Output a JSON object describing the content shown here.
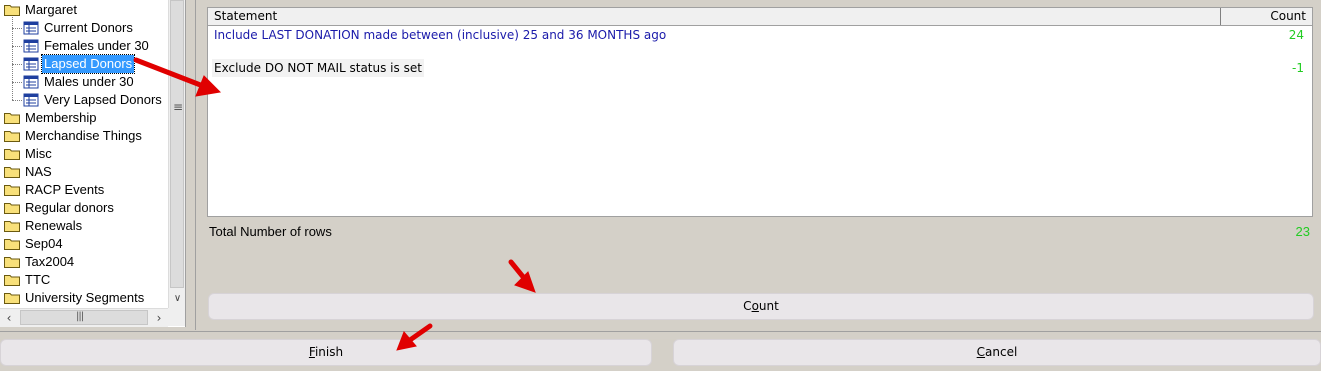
{
  "tree": {
    "items": [
      {
        "label": "Margaret",
        "type": "folder"
      },
      {
        "label": "Current Donors",
        "type": "query"
      },
      {
        "label": "Females under 30",
        "type": "query"
      },
      {
        "label": "Lapsed Donors",
        "type": "query",
        "selected": true
      },
      {
        "label": "Males under 30",
        "type": "query"
      },
      {
        "label": "Very Lapsed Donors",
        "type": "query"
      },
      {
        "label": "Membership",
        "type": "folder"
      },
      {
        "label": "Merchandise Things",
        "type": "folder"
      },
      {
        "label": "Misc",
        "type": "folder"
      },
      {
        "label": "NAS",
        "type": "folder"
      },
      {
        "label": "RACP Events",
        "type": "folder"
      },
      {
        "label": "Regular donors",
        "type": "folder"
      },
      {
        "label": "Renewals",
        "type": "folder"
      },
      {
        "label": "Sep04",
        "type": "folder"
      },
      {
        "label": "Tax2004",
        "type": "folder"
      },
      {
        "label": "TTC",
        "type": "folder"
      },
      {
        "label": "University Segments",
        "type": "folder"
      }
    ]
  },
  "grid": {
    "headers": {
      "statement": "Statement",
      "count": "Count"
    },
    "rows": [
      {
        "statement": "Include LAST DONATION made between (inclusive) 25 and 36 MONTHS ago",
        "count": "24"
      },
      {
        "statement": "Exclude DO NOT MAIL status is set",
        "count": "-1"
      }
    ]
  },
  "total": {
    "label": "Total Number of rows",
    "value": "23"
  },
  "buttons": {
    "count": {
      "pre": "C",
      "accel": "o",
      "post": "unt"
    },
    "finish": {
      "pre": "",
      "accel": "F",
      "post": "inish"
    },
    "cancel": {
      "pre": "",
      "accel": "C",
      "post": "ancel"
    }
  },
  "colors": {
    "count_green": "#22cc22",
    "selection": "#3399ff",
    "arrow_red": "#e00000",
    "include_blue": "#1a1aaa"
  }
}
